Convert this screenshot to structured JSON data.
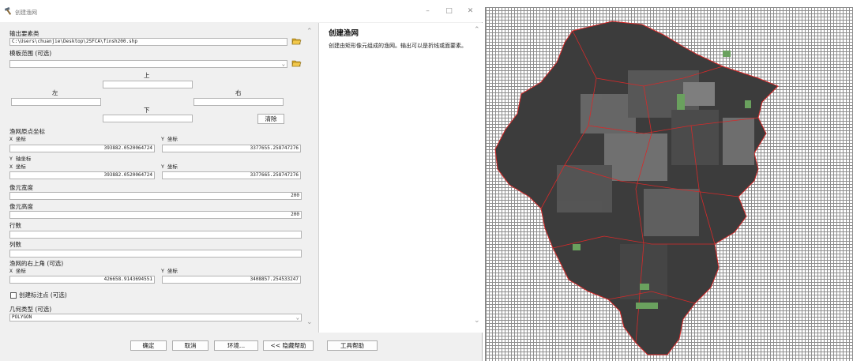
{
  "window": {
    "title": "创建渔网"
  },
  "form": {
    "output_label": "输出要素类",
    "output_value": "C:\\Users\\chuanjie\\Desktop\\2SFCA\\finsh200.shp",
    "template_label": "模板范围 (可选)",
    "template_value": "",
    "top_label": "上",
    "left_label": "左",
    "right_label": "右",
    "bottom_label": "下",
    "top_value": "",
    "left_value": "",
    "right_value": "",
    "bottom_value": "",
    "clear_button": "清除",
    "origin_label": "渔网原点坐标",
    "origin_x_label": "X 坐标",
    "origin_y_label": "Y 坐标",
    "origin_x": "393882.0520064724",
    "origin_y": "3377655.258747276",
    "yaxis_label": "Y 轴坐标",
    "yaxis_x_label": "X 坐标",
    "yaxis_y_label": "Y 坐标",
    "yaxis_x": "393882.0520064724",
    "yaxis_y": "3377665.258747276",
    "cell_width_label": "像元宽度",
    "cell_width": "200",
    "cell_height_label": "像元高度",
    "cell_height": "200",
    "rows_label": "行数",
    "rows_value": "",
    "cols_label": "列数",
    "cols_value": "",
    "corner_label": "渔网的右上角 (可选)",
    "corner_x_label": "X 坐标",
    "corner_y_label": "Y 坐标",
    "corner_x": "426658.9143694551",
    "corner_y": "3408857.254533247",
    "label_points_checkbox": "创建标注点 (可选)",
    "label_points_checked": false,
    "geometry_label": "几何类型 (可选)",
    "geometry_value": "POLYGON"
  },
  "buttons": {
    "ok": "确定",
    "cancel": "取消",
    "environments": "环境...",
    "hide_help": "<< 隐藏帮助",
    "tool_help": "工具帮助"
  },
  "help": {
    "title": "创建渔网",
    "body": "创建由矩形像元组成的渔网。输出可以是折线或面要素。"
  },
  "icons": {
    "title_icon": "hammer-icon",
    "browse_icon": "folder-open-icon",
    "minimize": "minimize-icon",
    "maximize": "maximize-icon",
    "close": "close-icon"
  },
  "colors": {
    "district_fill": "#3c3c3c",
    "boundary": "#d62a2a",
    "green_space": "#6aa15e",
    "grid": "#8e8e8e"
  }
}
